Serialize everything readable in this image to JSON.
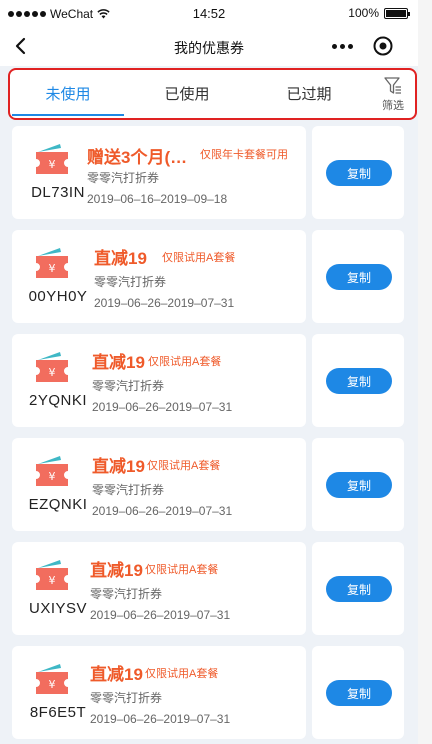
{
  "status_bar": {
    "carrier": "WeChat",
    "time": "14:52",
    "battery": "100%"
  },
  "nav": {
    "title": "我的优惠券"
  },
  "tabs": [
    {
      "label": "未使用",
      "active": true
    },
    {
      "label": "已使用",
      "active": false
    },
    {
      "label": "已过期",
      "active": false
    }
  ],
  "filter": {
    "label": "筛选"
  },
  "colors": {
    "accent": "#1e88e5",
    "coupon_red": "#ef5a2a",
    "ticket_icon": "#f26d5e",
    "highlight_border": "#e02222"
  },
  "coupons": [
    {
      "code": "DL73IN",
      "title": "赠送3个月(…",
      "limit": "仅限年卡套餐可用",
      "type": "零零汽打折券",
      "date": "2019–06–16–2019–09–18",
      "copy_label": "复制"
    },
    {
      "code": "00YH0Y",
      "title": "直减19",
      "limit": "仅限试用A套餐",
      "type": "零零汽打折券",
      "date": "2019–06–26–2019–07–31",
      "copy_label": "复制"
    },
    {
      "code": "2YQNKI",
      "title": "直减19",
      "limit": "仅限试用A套餐",
      "type": "零零汽打折券",
      "date": "2019–06–26–2019–07–31",
      "copy_label": "复制"
    },
    {
      "code": "EZQNKI",
      "title": "直减19",
      "limit": "仅限试用A套餐",
      "type": "零零汽打折券",
      "date": "2019–06–26–2019–07–31",
      "copy_label": "复制"
    },
    {
      "code": "UXIYSV",
      "title": "直减19",
      "limit": "仅限试用A套餐",
      "type": "零零汽打折券",
      "date": "2019–06–26–2019–07–31",
      "copy_label": "复制"
    },
    {
      "code": "8F6E5T",
      "title": "直减19",
      "limit": "仅限试用A套餐",
      "type": "零零汽打折券",
      "date": "2019–06–26–2019–07–31",
      "copy_label": "复制"
    }
  ]
}
